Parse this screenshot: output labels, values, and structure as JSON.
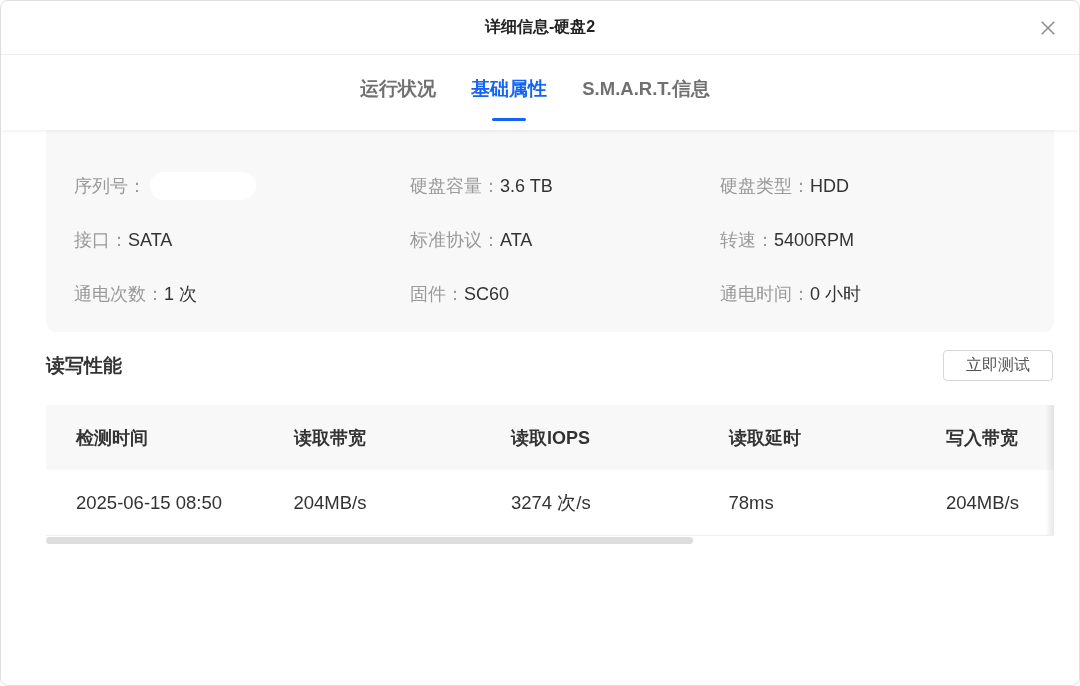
{
  "dialog": {
    "title": "详细信息-硬盘2"
  },
  "tabs": [
    {
      "label": "运行状况",
      "selected": false
    },
    {
      "label": "基础属性",
      "selected": true
    },
    {
      "label": "S.M.A.R.T.信息",
      "selected": false
    }
  ],
  "properties": [
    {
      "label": "序列号：",
      "redacted": true
    },
    {
      "label": "硬盘容量：",
      "value": "3.6 TB",
      "redacted": false
    },
    {
      "label": "硬盘类型：",
      "value": "HDD",
      "redacted": false
    },
    {
      "label": "接口：",
      "value": "SATA",
      "redacted": false
    },
    {
      "label": "标准协议：",
      "value": "ATA",
      "redacted": false
    },
    {
      "label": "转速：",
      "value": "5400RPM",
      "redacted": false
    },
    {
      "label": "通电次数：",
      "value": "1 次",
      "redacted": false
    },
    {
      "label": "固件：",
      "value": "SC60",
      "redacted": false
    },
    {
      "label": "通电时间：",
      "value": "0 小时",
      "redacted": false
    }
  ],
  "performance": {
    "title": "读写性能",
    "test_button": "立即测试",
    "table": {
      "columns": [
        "检测时间",
        "读取带宽",
        "读取IOPS",
        "读取延时",
        "写入带宽"
      ],
      "rows": [
        [
          "2025-06-15 08:50",
          "204MB/s",
          "3274 次/s",
          "78ms",
          "204MB/s"
        ]
      ]
    }
  }
}
